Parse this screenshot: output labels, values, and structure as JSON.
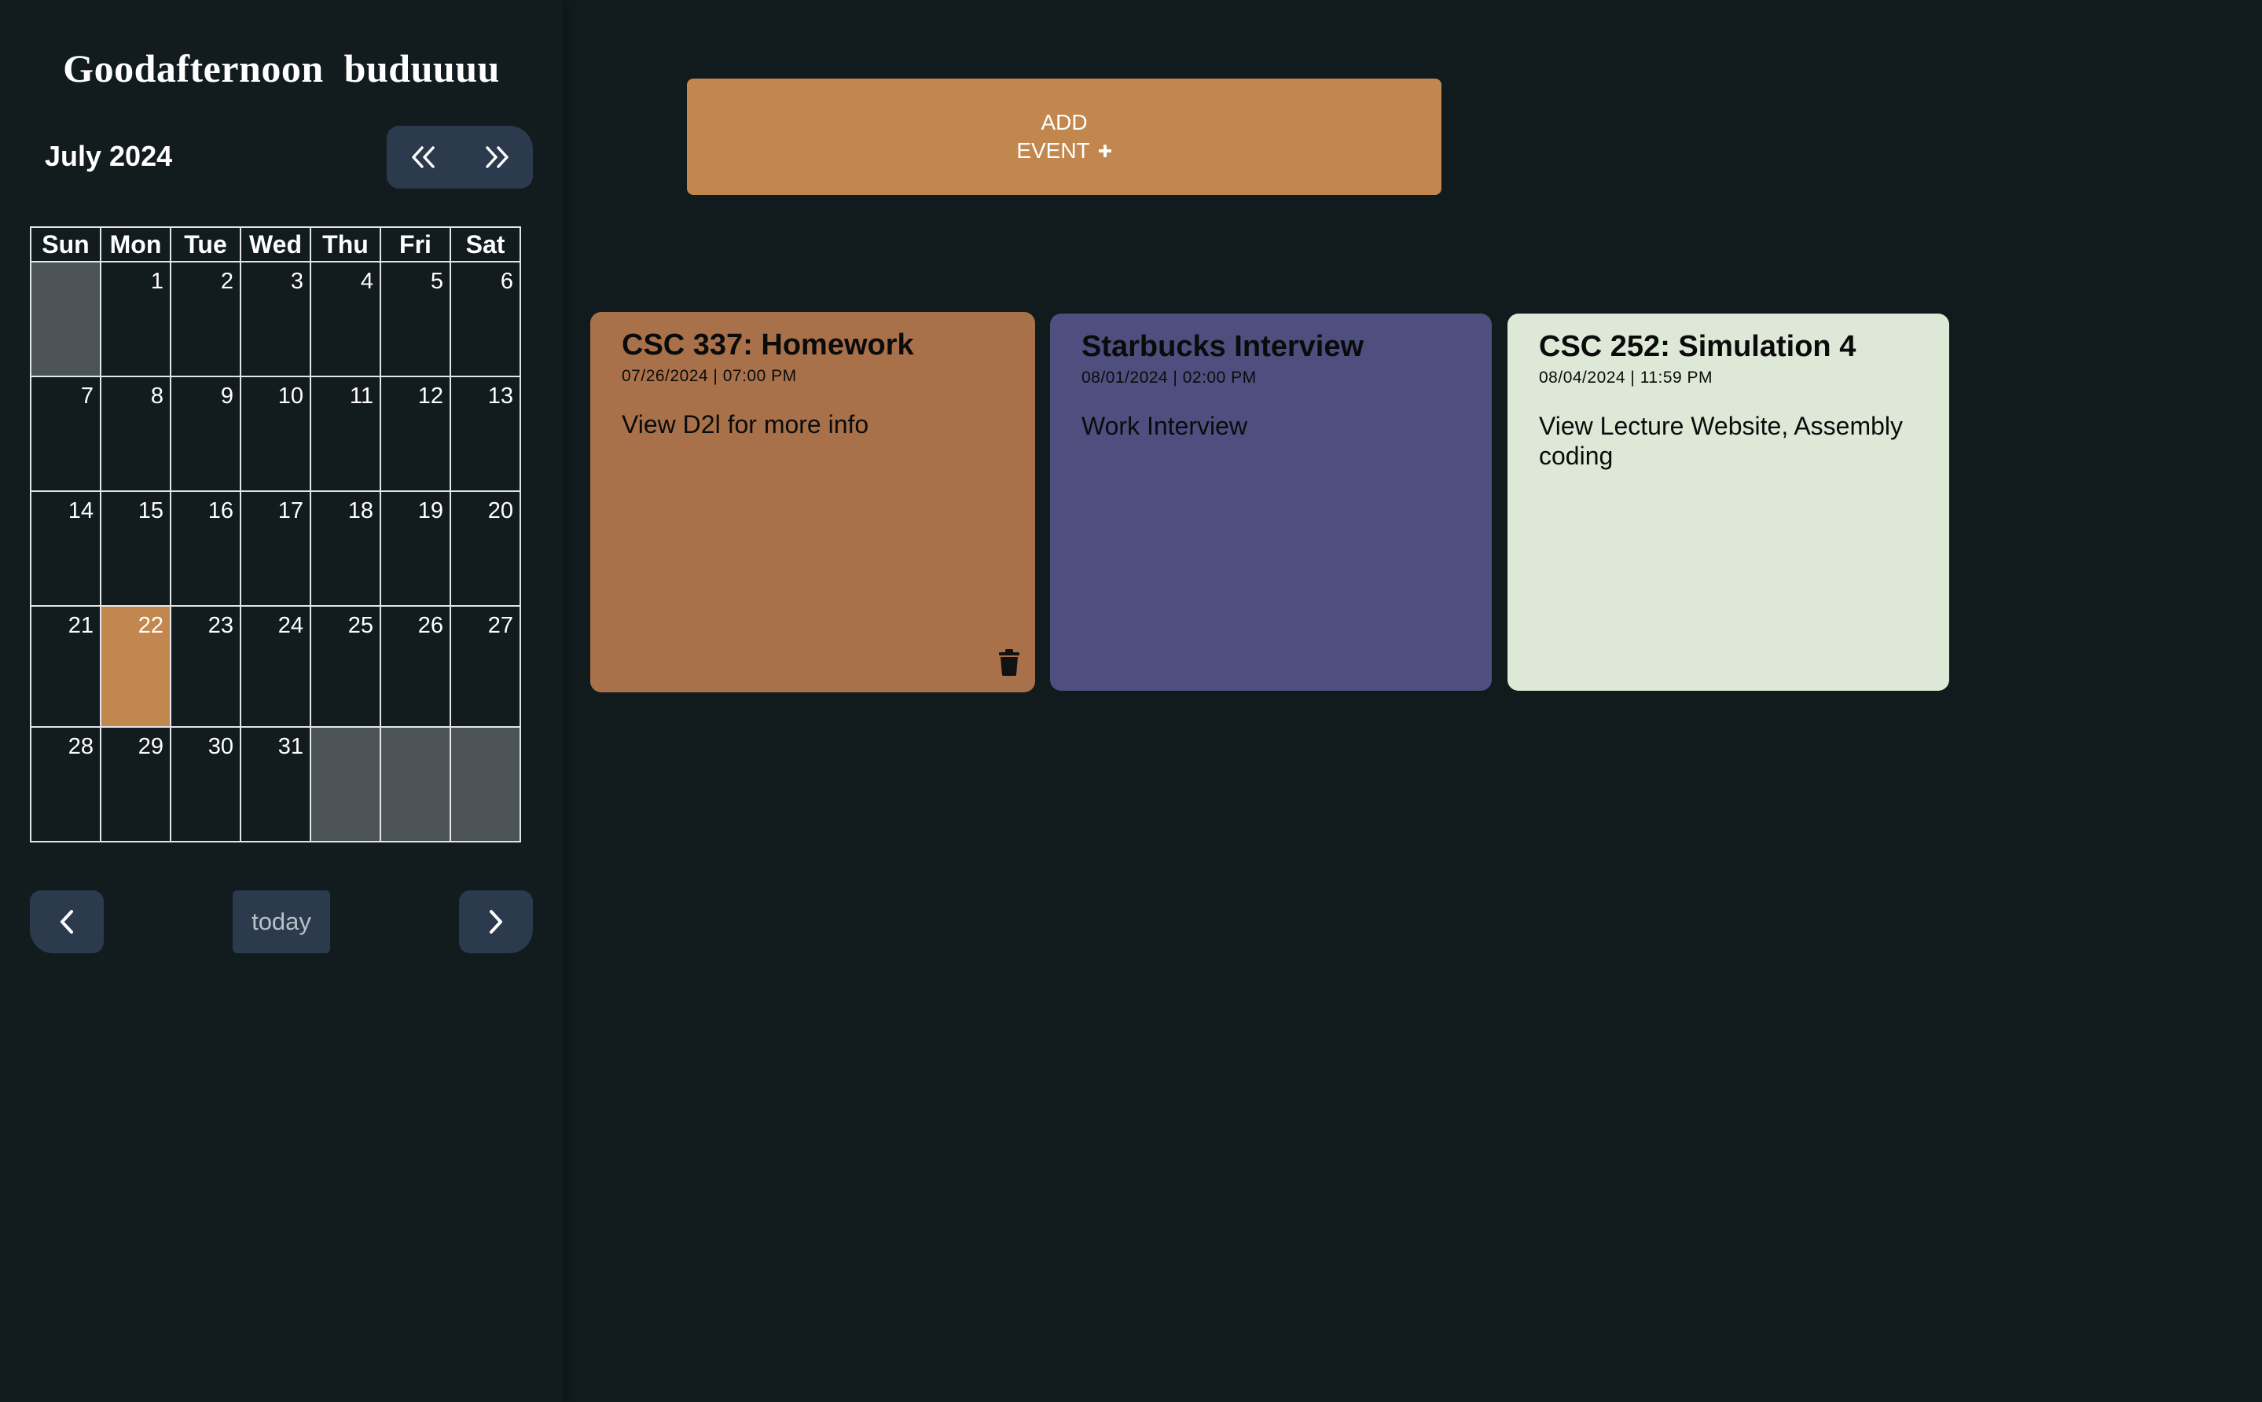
{
  "sidebar": {
    "greeting": "Goodafternoon  buduuuu",
    "month_title": "July 2024",
    "weekdays": [
      "Sun",
      "Mon",
      "Tue",
      "Wed",
      "Thu",
      "Fri",
      "Sat"
    ],
    "weeks": [
      [
        "",
        "1",
        "2",
        "3",
        "4",
        "5",
        "6"
      ],
      [
        "7",
        "8",
        "9",
        "10",
        "11",
        "12",
        "13"
      ],
      [
        "14",
        "15",
        "16",
        "17",
        "18",
        "19",
        "20"
      ],
      [
        "21",
        "22",
        "23",
        "24",
        "25",
        "26",
        "27"
      ],
      [
        "28",
        "29",
        "30",
        "31",
        "",
        "",
        ""
      ]
    ],
    "selected_day": "22",
    "today_label": "today"
  },
  "main": {
    "add_event": {
      "line1": "ADD",
      "line2": "EVENT"
    },
    "events": [
      {
        "title": "CSC 337: Homework",
        "datetime": "07/26/2024 | 07:00 PM",
        "description": "View D2l for more info",
        "color": "#a8714a"
      },
      {
        "title": "Starbucks Interview",
        "datetime": "08/01/2024 | 02:00 PM",
        "description": "Work Interview",
        "color": "#4e4f7f"
      },
      {
        "title": "CSC 252: Simulation 4",
        "datetime": "08/04/2024 | 11:59 PM",
        "description": "View Lecture Website, Assembly coding",
        "color": "#dde8d6"
      }
    ]
  },
  "colors": {
    "background": "#111a1d",
    "accent": "#c2874f",
    "nav_button": "#2c3a4d",
    "empty_cell": "#4c5357"
  },
  "icons": {
    "year_prev": "double-chevron-left-icon",
    "year_next": "double-chevron-right-icon",
    "month_prev": "chevron-left-icon",
    "month_next": "chevron-right-icon",
    "add": "plus-icon",
    "delete": "trash-icon"
  }
}
